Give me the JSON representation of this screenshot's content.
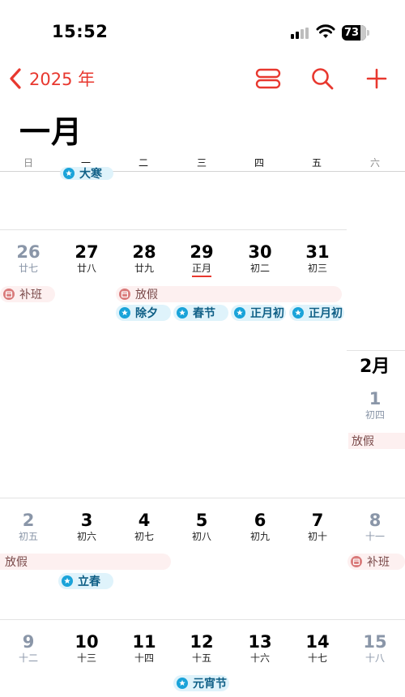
{
  "status_bar": {
    "time": "15:52",
    "battery": "73"
  },
  "nav": {
    "back_label": "2025 年"
  },
  "month_title": "一月",
  "weekdays": [
    "日",
    "一",
    "二",
    "三",
    "四",
    "五",
    "六"
  ],
  "colors": {
    "accent": "#e8382f",
    "holiday_bg": "#dff3fb",
    "holiday_text": "#0f5f86",
    "vacation_bg": "#fdf0f0",
    "vacation_text": "#7a4a4a",
    "weekend": "#8a96a8"
  },
  "partial_event": "大寒",
  "weeks": [
    {
      "days": [
        {
          "num": "26",
          "lunar": "廿七"
        },
        {
          "num": "27",
          "lunar": "廿八"
        },
        {
          "num": "28",
          "lunar": "廿九"
        },
        {
          "num": "29",
          "lunar": "正月",
          "today": true
        },
        {
          "num": "30",
          "lunar": "初二"
        },
        {
          "num": "31",
          "lunar": "初三"
        }
      ],
      "events": [
        "补班",
        "放假",
        "除夕",
        "春节",
        "正月初",
        "正月初"
      ]
    },
    {
      "month_label": "2月",
      "days": [
        {
          "num": "1",
          "lunar": "初四"
        }
      ],
      "events": [
        "放假"
      ]
    },
    {
      "days": [
        {
          "num": "2",
          "lunar": "初五"
        },
        {
          "num": "3",
          "lunar": "初六"
        },
        {
          "num": "4",
          "lunar": "初七"
        },
        {
          "num": "5",
          "lunar": "初八"
        },
        {
          "num": "6",
          "lunar": "初九"
        },
        {
          "num": "7",
          "lunar": "初十"
        },
        {
          "num": "8",
          "lunar": "十一"
        }
      ],
      "events": [
        "放假",
        "补班",
        "立春"
      ]
    },
    {
      "days": [
        {
          "num": "9",
          "lunar": "十二"
        },
        {
          "num": "10",
          "lunar": "十三"
        },
        {
          "num": "11",
          "lunar": "十四"
        },
        {
          "num": "12",
          "lunar": "十五"
        },
        {
          "num": "13",
          "lunar": "十六"
        },
        {
          "num": "14",
          "lunar": "十七"
        },
        {
          "num": "15",
          "lunar": "十八"
        }
      ],
      "events": [
        "元宵节"
      ]
    }
  ]
}
